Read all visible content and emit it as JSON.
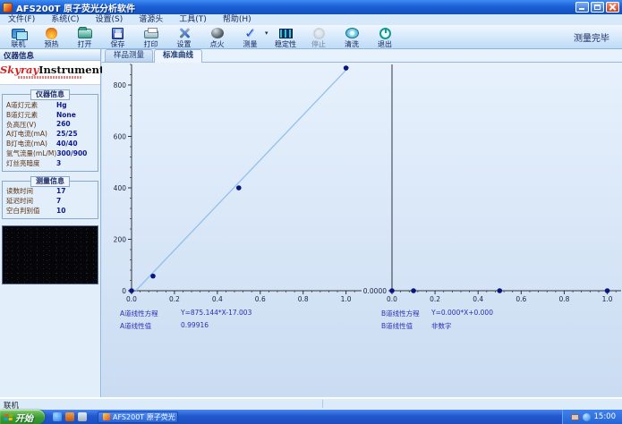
{
  "window": {
    "title": "AFS200T 原子荧光分析软件"
  },
  "menu": {
    "items": [
      "文件(F)",
      "系统(C)",
      "设置(S)",
      "谱源头",
      "工具(T)",
      "帮助(H)"
    ]
  },
  "toolbar": {
    "status": "测量完毕",
    "buttons": [
      {
        "label": "联机"
      },
      {
        "label": "预热"
      },
      {
        "label": "打开"
      },
      {
        "label": "保存"
      },
      {
        "label": "打印"
      },
      {
        "label": "设置"
      },
      {
        "label": "点火"
      },
      {
        "label": "测量"
      },
      {
        "label": "稳定性"
      },
      {
        "label": "停止"
      },
      {
        "label": "清洗"
      },
      {
        "label": "退出"
      }
    ]
  },
  "sidebar": {
    "pane_title": "仪器信息",
    "logo": {
      "brand_em": "Skyray",
      "brand": "Instrument"
    },
    "instrument": {
      "title": "仪器信息",
      "rows": [
        {
          "label": "A道灯元素",
          "value": "Hg"
        },
        {
          "label": "B道灯元素",
          "value": "None"
        },
        {
          "label": "负高压(V)",
          "value": "260"
        },
        {
          "label": "A灯电流(mA)",
          "value": "25/25"
        },
        {
          "label": "B灯电流(mA)",
          "value": "40/40"
        },
        {
          "label": "氩气流量(mL/M)",
          "value": "300/900"
        },
        {
          "label": "灯丝亮暗度",
          "value": "3"
        }
      ]
    },
    "measurement": {
      "title": "测量信息",
      "rows": [
        {
          "label": "读数时间",
          "value": "17"
        },
        {
          "label": "延迟时间",
          "value": "7"
        },
        {
          "label": "空白判别值",
          "value": "10"
        }
      ]
    }
  },
  "tabs": [
    {
      "label": "样品测量"
    },
    {
      "label": "标准曲线"
    }
  ],
  "chart_data": [
    {
      "type": "scatter",
      "name": "A-channel standard curve",
      "x": [
        0,
        0.1,
        0.5,
        1.0
      ],
      "y": [
        0,
        57,
        400,
        866
      ],
      "xlim": [
        0,
        1.06
      ],
      "ylim": [
        0,
        880
      ],
      "xticks": [
        {
          "v": 0,
          "label": "0.0"
        },
        {
          "v": 0.2,
          "label": "0.2"
        },
        {
          "v": 0.4,
          "label": "0.4"
        },
        {
          "v": 0.6,
          "label": "0.6"
        },
        {
          "v": 0.8,
          "label": "0.8"
        },
        {
          "v": 1.0,
          "label": "1.0"
        }
      ],
      "yticks": [
        {
          "v": 0,
          "label": "0"
        },
        {
          "v": 200,
          "label": "200"
        },
        {
          "v": 400,
          "label": "400"
        },
        {
          "v": 600,
          "label": "600"
        },
        {
          "v": 800,
          "label": "800"
        }
      ],
      "yminor": 40,
      "xminor": 0.04,
      "grid": false,
      "legend": "none",
      "line": {
        "slope": 875.144,
        "intercept": -17.003
      },
      "equation_label": "A道线性方程",
      "equation": "Y=875.144*X-17.003",
      "r_label": "A道线性值",
      "r_value": "0.99916"
    },
    {
      "type": "scatter",
      "name": "B-channel standard curve",
      "x": [
        0,
        0.1,
        0.5,
        1.0
      ],
      "y": [
        0,
        0,
        0,
        0
      ],
      "xlim": [
        0,
        1.06
      ],
      "ylim": [
        0,
        880
      ],
      "xticks": [
        {
          "v": 0,
          "label": "0.0"
        },
        {
          "v": 0.2,
          "label": "0.2"
        },
        {
          "v": 0.4,
          "label": "0.4"
        },
        {
          "v": 0.6,
          "label": "0.6"
        },
        {
          "v": 0.8,
          "label": "0.8"
        },
        {
          "v": 1.0,
          "label": "1.0"
        }
      ],
      "yticks": [
        {
          "v": 0,
          "label": "0.0000"
        }
      ],
      "yminor": 0,
      "xminor": 0.04,
      "grid": false,
      "legend": "none",
      "line": null,
      "equation_label": "B道线性方程",
      "equation": "Y=0.000*X+0.000",
      "r_label": "B道线性值",
      "r_value": "非数字"
    }
  ],
  "statusbar": {
    "text": "联机"
  },
  "taskbar": {
    "start_label": "开始",
    "task_label": "AFS200T 原子荧光",
    "time": "15:00"
  },
  "colors": {
    "curve": "#8fc1ee",
    "point": "#0a1580",
    "axis": "#30343c",
    "titlebar": "#1b61d8",
    "taskbar": "#2258ce"
  }
}
